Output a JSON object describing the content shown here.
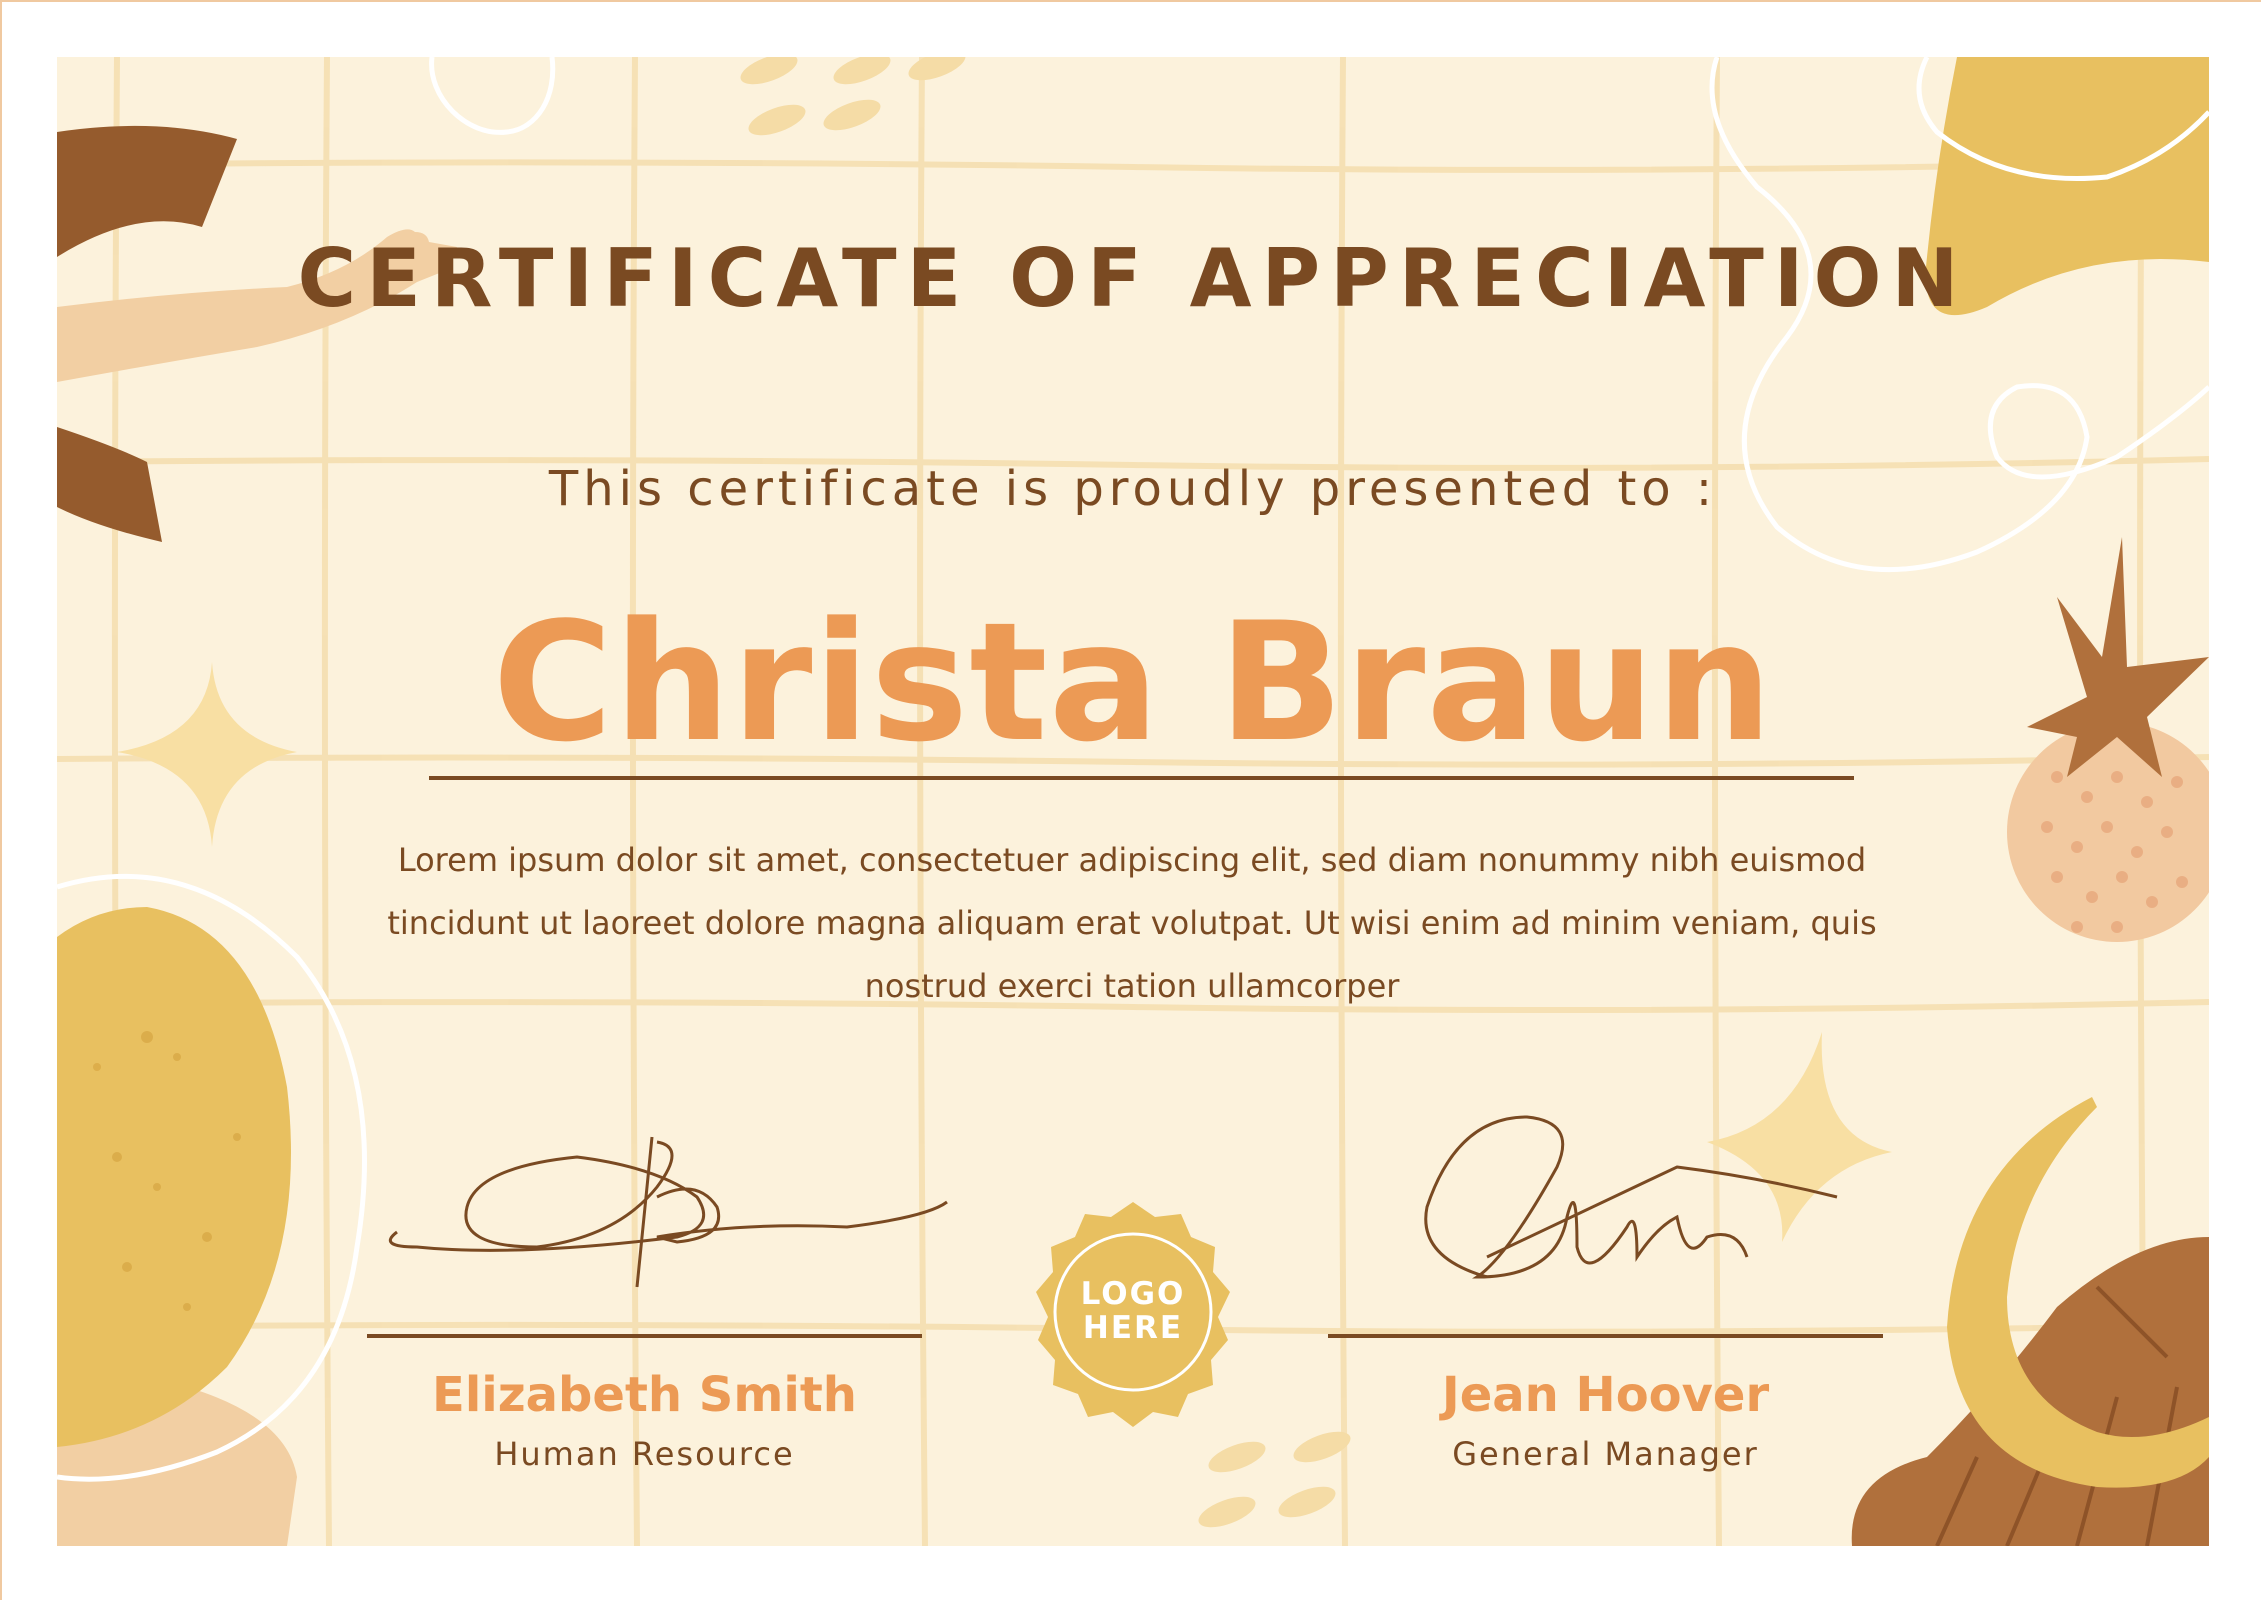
{
  "certificate": {
    "title": "CERTIFICATE OF APPRECIATION",
    "subtitle": "This certificate is proudly presented to :",
    "recipient": "Christa Braun",
    "body": "Lorem ipsum dolor sit amet, consectetuer adipiscing elit, sed diam nonummy nibh euismod tincidunt ut laoreet dolore magna aliquam erat volutpat. Ut wisi enim ad minim veniam, quis nostrud exerci tation ullamcorper"
  },
  "signatories": [
    {
      "name": "Elizabeth Smith",
      "role": "Human Resource"
    },
    {
      "name": "Jean Hoover",
      "role": "General Manager"
    }
  ],
  "seal": {
    "line1": "LOGO",
    "line2": "HERE"
  },
  "colors": {
    "background": "#fcf2dc",
    "brown": "#7a4a22",
    "orange": "#ec9a55",
    "mustard": "#e8c060",
    "peach": "#f2cfa3"
  }
}
